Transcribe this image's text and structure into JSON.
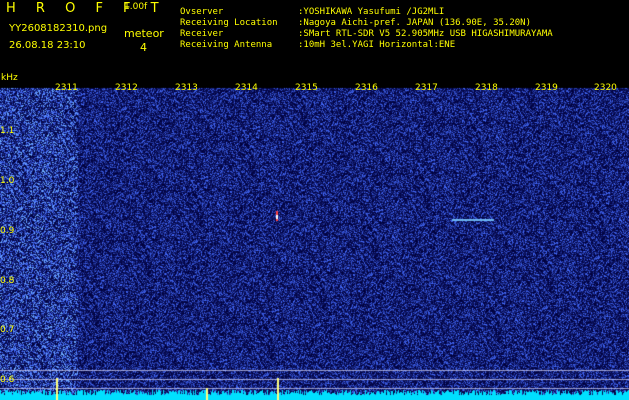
{
  "header": {
    "app_title": "H R O F F T",
    "version": "1.00f",
    "file_name": "YY2608182310.png",
    "timestamp": "26.08.18 23:10",
    "meteor_label": "meteor",
    "meteor_count": "4"
  },
  "info": {
    "observer_label": "Ovserver",
    "observer_value": ":YOSHIKAWA Yasufumi /JG2MLI",
    "location_label": "Receiving Location",
    "location_value": ":Nagoya Aichi-pref. JAPAN (136.90E, 35.20N)",
    "receiver_label": "Receiver",
    "receiver_value": ":SMart RTL-SDR V5 52.905MHz USB HIGASHIMURAYAMA",
    "antenna_label": "Receiving Antenna",
    "antenna_value": ":10mH 3el.YAGI Horizontal:ENE"
  },
  "axis": {
    "y_unit": "kHz",
    "y_ticks": [
      "1.1",
      "1.0",
      "0.9",
      "0.8",
      "0.7",
      "0.6"
    ],
    "x_ticks": [
      "2311",
      "2312",
      "2313",
      "2314",
      "2315",
      "2316",
      "2317",
      "2318",
      "2319",
      "2320"
    ]
  },
  "colors": {
    "text": "#ffff00",
    "noise_base": "#000050",
    "noise_bright": "#3a5cff",
    "baseline": "#00e0ff",
    "echo": "#ff4040"
  }
}
